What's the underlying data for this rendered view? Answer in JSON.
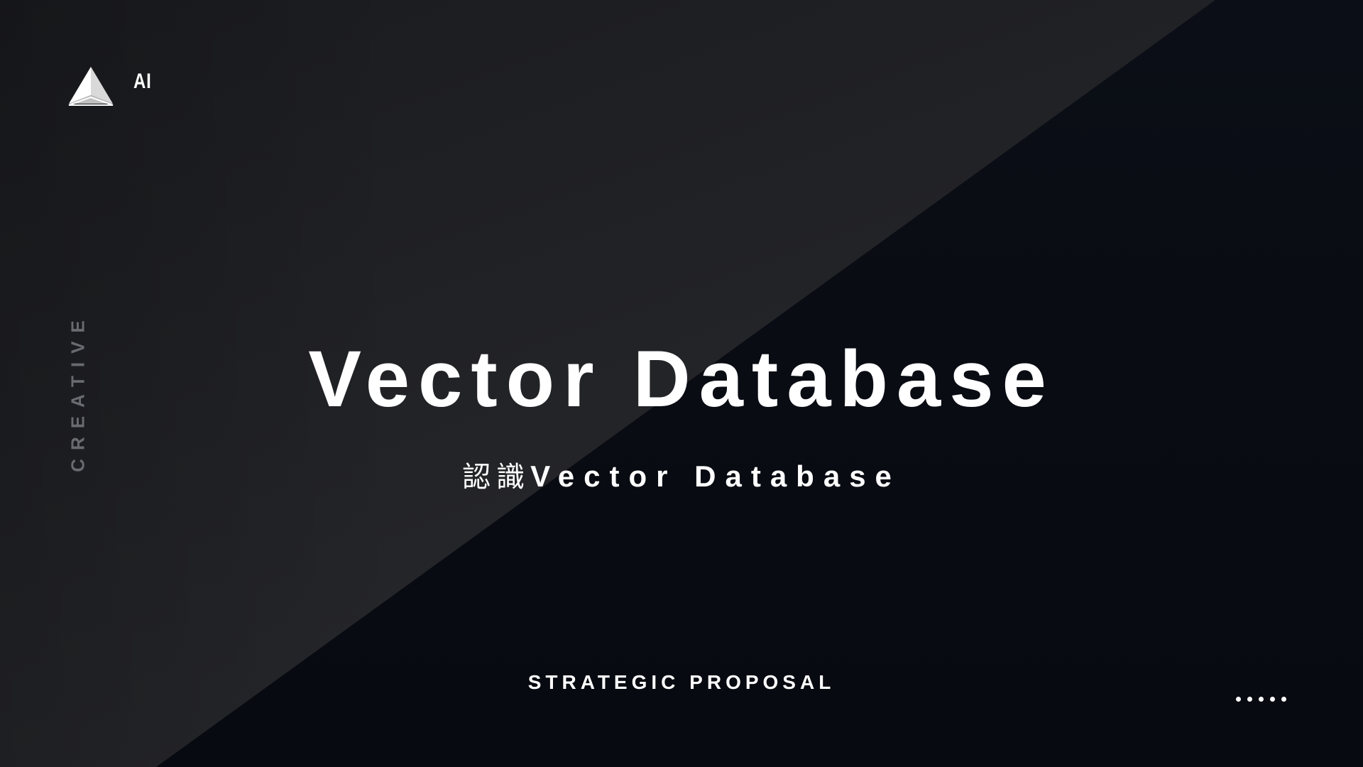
{
  "header": {
    "logo_text": "AI",
    "logo_icon": "triangle-prism-icon"
  },
  "side_label": "CREATIVE",
  "main": {
    "title": "Vector Database",
    "subtitle_zh": "認識",
    "subtitle_en": "Vector Database"
  },
  "footer": {
    "label": "STRATEGIC PROPOSAL",
    "pagination_dots_count": 5
  },
  "colors": {
    "background_dark": "#0a0c12",
    "background_light": "#26272b",
    "text": "#ffffff",
    "side_label": "#6a6b70"
  }
}
